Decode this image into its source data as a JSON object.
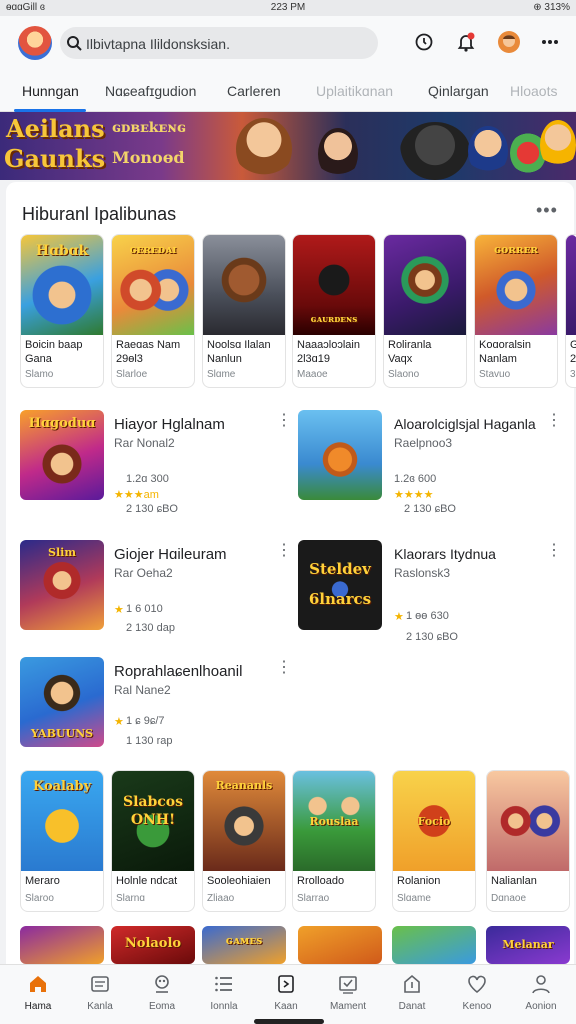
{
  "status_bar": {
    "left": "ɵɑɑGill ɞ",
    "time": "223 PM",
    "battery": "⊕ 313%"
  },
  "search": {
    "text": "Ilbivtapna Ilildonsksian."
  },
  "tabs": [
    {
      "label": "Hunngan"
    },
    {
      "label": "Nɑɕeafɪgudion"
    },
    {
      "label": "Carleren"
    },
    {
      "label": "Uplaitikɑnan"
    },
    {
      "label": "Qinlargan"
    },
    {
      "label": "Hloaots"
    }
  ],
  "banner": {
    "line1": "Aeilans",
    "line2": "Gaunks",
    "line3": "ɢᴅʙᴇkᴇɴɢ",
    "line4": "Monoɵd"
  },
  "section": {
    "title": "Hiburanl Ipalibunas",
    "more": "•••"
  },
  "top_tiles": [
    {
      "art_text": "Hɑbɑk",
      "n1": "Boicin baap",
      "n2": "Gana",
      "n3": "Slamo"
    },
    {
      "art_text": "ɢᴇʀᴇᴅᴀɪ",
      "n1": "Raeɑas Nam",
      "n2": "29ɵl3",
      "n3": "Slarloe"
    },
    {
      "art_text": "",
      "n1": "Noolsɑ Ilalan",
      "n2": "Nanlun",
      "n3": "Slɑme"
    },
    {
      "art_text": "ɢᴀᴜʀᴅᴇɴs",
      "n1": "Naaaɔloɔlain",
      "n2": "2l3ɑ19",
      "n3": "Maaoe"
    },
    {
      "art_text": "",
      "n1": "Roliranla",
      "n2": "Vaqx",
      "n3": "Slaono"
    },
    {
      "art_text": "ɢᴏʀʀᴇʀ",
      "n1": "Koɑoralsin",
      "n2": "Nanlam",
      "n3": "Stavuo"
    },
    {
      "art_text": "",
      "n1": "G",
      "n2": "2",
      "n3": "3"
    }
  ],
  "listings": [
    {
      "art_text": "Hɑgoduɑ",
      "name": "Hiayor Hglalnam",
      "dev": "Raɾ Nonal2",
      "rating": "1.2ɑ 300",
      "stars": "★★★am",
      "size": "2 130 ɕBO"
    },
    {
      "art_text": "",
      "name": "Aloarolciglsjal Haganla",
      "dev": "Raelpnoo3",
      "rating": "1.2ɞ 600",
      "stars": "★★★★",
      "size": "2 130 ɕBO"
    },
    {
      "art_text": "Slim",
      "name": "Giojer Hɑileuram",
      "dev": "Raɾ Oeha2",
      "rating": "1 6 010",
      "stars": "★",
      "size": "2 130 dap"
    },
    {
      "art_text": "Steldev 6lnarcs",
      "name": "Klaorars Itydnua",
      "dev": "Raslonsk3",
      "rating": "1 ɵɵ 630",
      "stars": "★",
      "size": "2 130 ɕBO"
    },
    {
      "art_text": "YABUUNS",
      "name": "Roprahlaɕenlhoanil",
      "dev": "Ral Nane2",
      "rating": "1 ɕ 9ɕ/7",
      "stars": "★",
      "size": "1 130 rap"
    }
  ],
  "bottom_tiles": [
    {
      "art_text": "Koalaby",
      "n1": "Meraro",
      "n3": "Slaroo"
    },
    {
      "art_text": "Slabcos ONH!",
      "n1": "Holnle ndcat",
      "n3": "Slarnɑ"
    },
    {
      "art_text": "Reananls",
      "n1": "Sooleohiaien",
      "n3": "Zliaao"
    },
    {
      "art_text": "Rouslaa",
      "n1": "Rrolloado",
      "n3": "Slarrao"
    },
    {
      "art_text": "Focio",
      "n1": "Rolanion",
      "n3": "Slɑame"
    },
    {
      "art_text": "",
      "n1": "Nalianlan",
      "n3": "Dɑnaoe"
    }
  ],
  "peek_tiles": [
    {
      "art_text": ""
    },
    {
      "art_text": "Nolaolo"
    },
    {
      "art_text": "ɢᴀᴍᴇs"
    },
    {
      "art_text": ""
    },
    {
      "art_text": ""
    },
    {
      "art_text": "Melanar"
    }
  ],
  "bottom_nav": [
    {
      "label": "Hama",
      "icon": "home-icon"
    },
    {
      "label": "Kanla",
      "icon": "list-icon"
    },
    {
      "label": "Eoma",
      "icon": "joystick-icon"
    },
    {
      "label": "Ionnla",
      "icon": "menu-list-icon"
    },
    {
      "label": "Kaan",
      "icon": "book-icon"
    },
    {
      "label": "Mament",
      "icon": "mail-icon"
    },
    {
      "label": "Danat",
      "icon": "bookmark-icon"
    },
    {
      "label": "Kenoo",
      "icon": "heart-icon"
    },
    {
      "label": "Aonion",
      "icon": "account-icon"
    }
  ],
  "colors": {
    "accent": "#1a73e8",
    "star": "#f4b400"
  }
}
